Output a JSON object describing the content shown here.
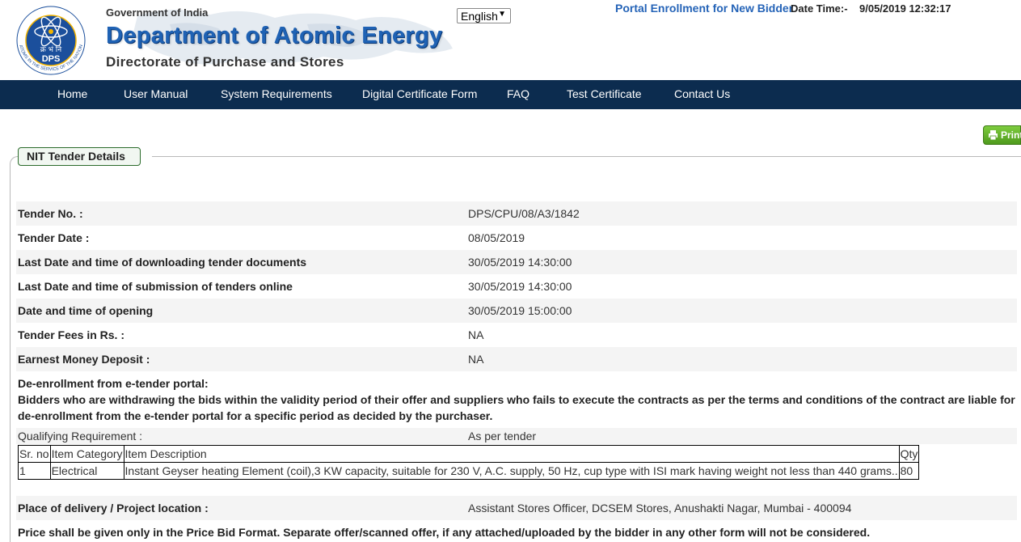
{
  "header": {
    "gov_text": "Government of India",
    "dept_title": "Department of Atomic Energy",
    "directorate": "Directorate of Purchase and Stores",
    "logo_text": "DPS",
    "logo_hindi": "क्र भं नि",
    "logo_ring_text": "ATOMS IN THE SERVICE OF THE NATION",
    "language": "English",
    "portal_link": "Portal Enrollment for New Bidder",
    "date_time_label": "Date Time:-",
    "date_time_value": "9/05/2019 12:32:17"
  },
  "nav": {
    "items": [
      "Home",
      "User Manual",
      "System Requirements",
      "Digital Certificate Form",
      "FAQ",
      "Test Certificate",
      "Contact Us"
    ]
  },
  "print_label": "Print",
  "section_title": "NIT Tender Details",
  "details": [
    {
      "label": "Tender No. :",
      "value": "DPS/CPU/08/A3/1842"
    },
    {
      "label": "Tender Date :",
      "value": "08/05/2019"
    },
    {
      "label": "Last Date and time of downloading tender documents",
      "value": "30/05/2019 14:30:00"
    },
    {
      "label": "Last Date and time of submission of tenders online",
      "value": "30/05/2019 14:30:00"
    },
    {
      "label": "Date and time of opening",
      "value": "30/05/2019 15:00:00"
    },
    {
      "label": "Tender Fees in Rs. :",
      "value": "NA"
    },
    {
      "label": "Earnest Money Deposit :",
      "value": "NA"
    }
  ],
  "deenroll": {
    "heading": "De-enrollment from e-tender portal:",
    "line1": "Bidders who are withdrawing the bids within the validity period of their offer and suppliers who fails to execute the contracts as per the terms and conditions of the contract are liable for",
    "line2": "de-enrollment from the e-tender portal for a specific period as decided by the purchaser."
  },
  "qualifying": {
    "label": "Qualifying Requirement :",
    "value": "As per tender"
  },
  "items_table": {
    "headers": [
      "Sr. no",
      "Item Category",
      "Item Description",
      "Qty"
    ],
    "rows": [
      [
        "1",
        "Electrical",
        "Instant Geyser heating Element (coil),3 KW capacity, suitable for 230 V, A.C. supply, 50 Hz, cup type with ISI mark having weight not less than 440 grams..",
        "80"
      ]
    ]
  },
  "delivery": {
    "label": "Place of delivery / Project location :",
    "value": "Assistant Stores Officer, DCSEM Stores, Anushakti Nagar, Mumbai - 400094"
  },
  "price_note": "Price shall be given only in the Price Bid Format. Separate offer/scanned offer, if any attached/uploaded by the bidder in any other form will not be considered."
}
